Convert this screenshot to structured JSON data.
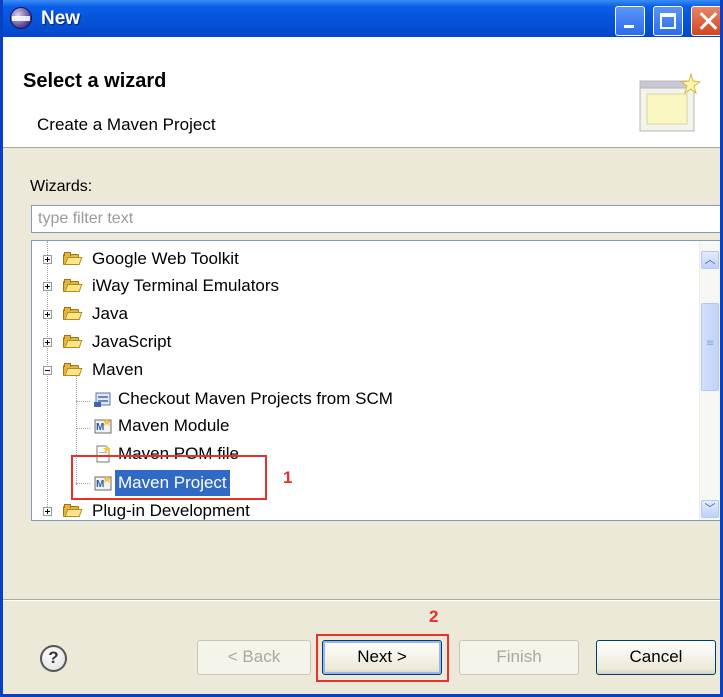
{
  "window": {
    "title": "New"
  },
  "header": {
    "title": "Select a wizard",
    "description": "Create a Maven Project"
  },
  "wizards": {
    "label": "Wizards:",
    "filter_placeholder": "type filter text"
  },
  "tree": {
    "items": [
      {
        "label": "Google Web Toolkit",
        "type": "folder",
        "expanded": false
      },
      {
        "label": "iWay Terminal Emulators",
        "type": "folder",
        "expanded": false
      },
      {
        "label": "Java",
        "type": "folder",
        "expanded": false
      },
      {
        "label": "JavaScript",
        "type": "folder",
        "expanded": false
      },
      {
        "label": "Maven",
        "type": "folder",
        "expanded": true
      },
      {
        "label": "Checkout Maven Projects from SCM",
        "type": "wizard",
        "icon": "scm-checkout-icon"
      },
      {
        "label": "Maven Module",
        "type": "wizard",
        "icon": "maven-module-icon"
      },
      {
        "label": "Maven POM file",
        "type": "wizard",
        "icon": "pom-file-icon"
      },
      {
        "label": "Maven Project",
        "type": "wizard",
        "icon": "maven-project-icon",
        "selected": true
      },
      {
        "label": "Plug-in Development",
        "type": "folder",
        "expanded": false
      }
    ]
  },
  "annotations": {
    "step1": "1",
    "step2": "2",
    "color": "#e8312c"
  },
  "buttons": {
    "help": "?",
    "back": "< Back",
    "next": "Next >",
    "finish": "Finish",
    "cancel": "Cancel"
  },
  "colors": {
    "selection": "#316ac5",
    "titlebar": "#0553d8",
    "folder": "#e5b53a"
  }
}
